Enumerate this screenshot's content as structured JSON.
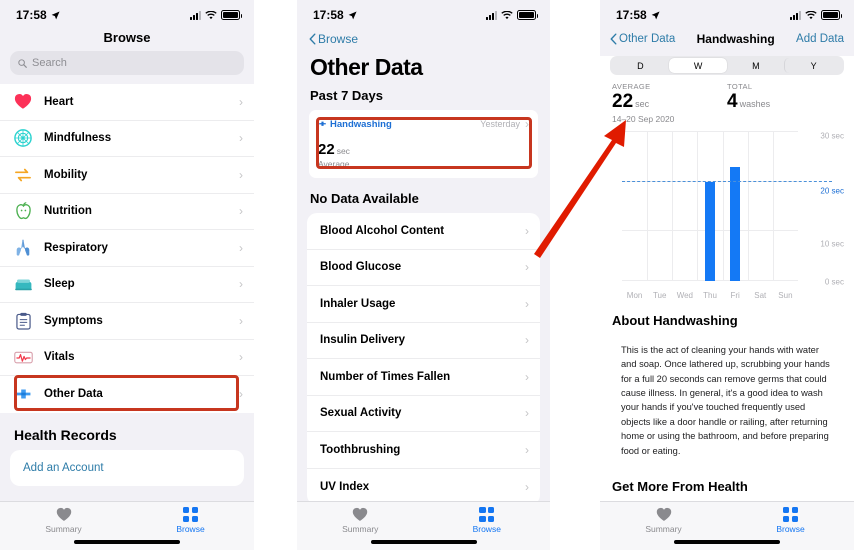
{
  "statusbar": {
    "time": "17:58",
    "icons": [
      "location-arrow",
      "cellular",
      "wifi",
      "battery"
    ]
  },
  "phone1": {
    "nav_title": "Browse",
    "search_placeholder": "Search",
    "categories": [
      {
        "label": "Heart",
        "icon": "heart-icon"
      },
      {
        "label": "Mindfulness",
        "icon": "mindfulness-icon"
      },
      {
        "label": "Mobility",
        "icon": "mobility-icon"
      },
      {
        "label": "Nutrition",
        "icon": "nutrition-icon"
      },
      {
        "label": "Respiratory",
        "icon": "respiratory-icon"
      },
      {
        "label": "Sleep",
        "icon": "sleep-icon"
      },
      {
        "label": "Symptoms",
        "icon": "symptoms-icon"
      },
      {
        "label": "Vitals",
        "icon": "vitals-icon"
      },
      {
        "label": "Other Data",
        "icon": "other-data-icon"
      }
    ],
    "health_records_header": "Health Records",
    "add_account_label": "Add an Account",
    "tabs": [
      {
        "label": "Summary",
        "icon": "heart-icon",
        "active": false
      },
      {
        "label": "Browse",
        "icon": "grid-icon",
        "active": true
      }
    ]
  },
  "phone2": {
    "back_label": "Browse",
    "title": "Other Data",
    "past_section": "Past 7 Days",
    "handwashing_card": {
      "name": "Handwashing",
      "when": "Yesterday",
      "value": "22",
      "unit": "sec",
      "sublabel": "Average"
    },
    "no_data_header": "No Data Available",
    "no_data_items": [
      "Blood Alcohol Content",
      "Blood Glucose",
      "Inhaler Usage",
      "Insulin Delivery",
      "Number of Times Fallen",
      "Sexual Activity",
      "Toothbrushing",
      "UV Index"
    ],
    "tabs": [
      {
        "label": "Summary",
        "icon": "heart-icon",
        "active": false
      },
      {
        "label": "Browse",
        "icon": "grid-icon",
        "active": true
      }
    ]
  },
  "phone3": {
    "back_label": "Other Data",
    "title": "Handwashing",
    "add_data_label": "Add Data",
    "segments": [
      {
        "label": "D",
        "selected": false
      },
      {
        "label": "W",
        "selected": true
      },
      {
        "label": "M",
        "selected": false
      },
      {
        "label": "Y",
        "selected": false
      }
    ],
    "stats": [
      {
        "caption": "AVERAGE",
        "value": "22",
        "unit": "sec"
      },
      {
        "caption": "TOTAL",
        "value": "4",
        "unit": "washes"
      }
    ],
    "date_range": "14–20 Sep 2020",
    "about_header": "About Handwashing",
    "about_text": "This is the act of cleaning your hands with water and soap. Once lathered up, scrubbing your hands for a full 20 seconds can remove germs that could cause illness. In general, it's a good idea to wash your hands if you've touched frequently used objects like a door handle or railing, after returning home or using the bathroom, and before preparing food or eating.",
    "get_more_header": "Get More From Health",
    "tabs": [
      {
        "label": "Summary",
        "icon": "heart-icon",
        "active": false
      },
      {
        "label": "Browse",
        "icon": "grid-icon",
        "active": true
      }
    ]
  },
  "chart_data": {
    "type": "bar",
    "title": "Handwashing — duration per day",
    "categories": [
      "Mon",
      "Tue",
      "Wed",
      "Thu",
      "Fri",
      "Sat",
      "Sun"
    ],
    "values": [
      0,
      0,
      0,
      20,
      23,
      0,
      0
    ],
    "ylabel": "sec",
    "xlabel": "",
    "ylim": [
      0,
      30
    ],
    "yticks": [
      0,
      10,
      20,
      30
    ],
    "ytick_labels": [
      "0 sec",
      "10 sec",
      "20 sec",
      "30 sec"
    ],
    "average_line": 20,
    "average_line_label": "20 sec",
    "grid": true,
    "legend": "none",
    "bar_color": "#1479f5",
    "average_line_color": "#4a90d9"
  },
  "annotations": {
    "highlight_color": "#c7361f",
    "arrow_color": "#e01b00",
    "arrow_label": "points from Handwashing row to Handwashing detail chart"
  }
}
